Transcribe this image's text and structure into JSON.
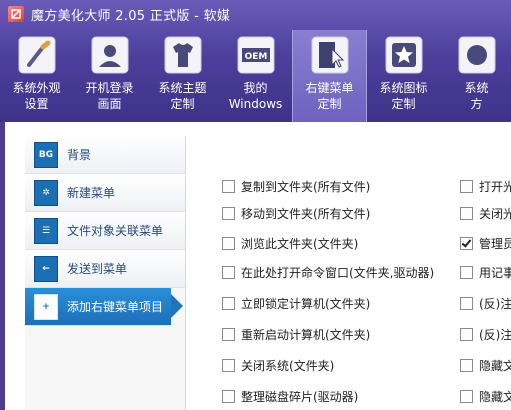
{
  "window": {
    "title": "魔方美化大师 2.05 正式版 - 软媒"
  },
  "tabs": [
    {
      "label": "系统外观\n设置",
      "icon": "paintbrush-icon"
    },
    {
      "label": "开机登录\n画面",
      "icon": "user-card-icon"
    },
    {
      "label": "系统主题\n定制",
      "icon": "tshirt-icon"
    },
    {
      "label": "我的\nWindows",
      "icon": "oem-icon"
    },
    {
      "label": "右键菜单\n定制",
      "icon": "context-menu-icon",
      "active": true
    },
    {
      "label": "系统图标\n定制",
      "icon": "star-icon"
    },
    {
      "label": "系统\n方",
      "icon": "partial-icon"
    }
  ],
  "sidebar": {
    "items": [
      {
        "label": "背景",
        "icon_text": "BG"
      },
      {
        "label": "新建菜单",
        "icon_text": "✲"
      },
      {
        "label": "文件对象关联菜单",
        "icon_text": "☰"
      },
      {
        "label": "发送到菜单",
        "icon_text": "←"
      },
      {
        "label": "添加右键菜单项目",
        "icon_text": "+"
      }
    ]
  },
  "options": {
    "col1": [
      {
        "label": "复制到文件夹(所有文件)",
        "checked": false
      },
      {
        "label": "移动到文件夹(所有文件)",
        "checked": false
      },
      {
        "label": "浏览此文件夹(文件夹)",
        "checked": false
      },
      {
        "label": "在此处打开命令窗口(文件夹,驱动器)",
        "checked": false
      },
      {
        "label": "立即锁定计算机(文件夹)",
        "checked": false
      },
      {
        "label": "重新启动计算机(文件夹)",
        "checked": false
      },
      {
        "label": "关闭系统(文件夹)",
        "checked": false
      },
      {
        "label": "整理磁盘碎片(驱动器)",
        "checked": false
      }
    ],
    "col2": [
      {
        "label": "打开光",
        "checked": false
      },
      {
        "label": "关闭光",
        "checked": false
      },
      {
        "label": "管理员",
        "checked": true
      },
      {
        "label": "用记事",
        "checked": false
      },
      {
        "label": "(反)注册",
        "checked": false
      },
      {
        "label": "(反)注册",
        "checked": false
      },
      {
        "label": "隐藏文",
        "checked": false
      },
      {
        "label": "隐藏文",
        "checked": false
      }
    ]
  },
  "colors": {
    "banner": "#4d3f9c",
    "active_tab": "#7a6ec8",
    "sidebar_active": "#1f74bd"
  }
}
